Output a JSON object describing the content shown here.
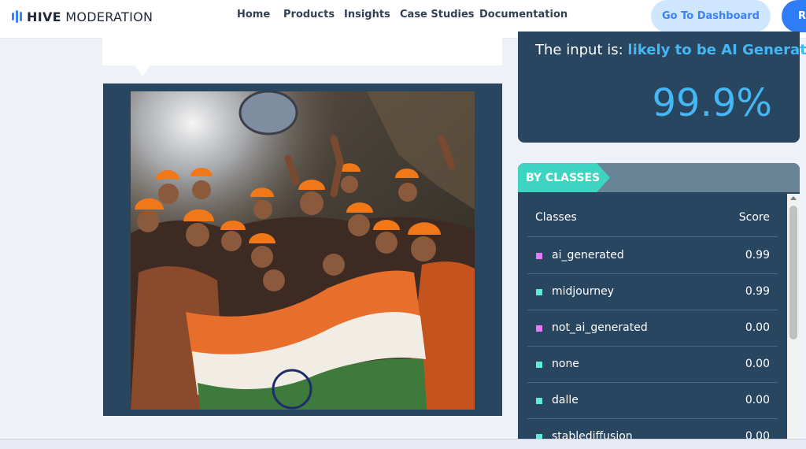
{
  "nav": {
    "brand_bold": "HIVE",
    "brand_light": "MODERATION",
    "links": [
      "Home",
      "Products",
      "Insights",
      "Case Studies",
      "Documentation"
    ],
    "dashboard_button": "Go To Dashboard",
    "cta_button_partial": "R"
  },
  "result": {
    "prefix": "The input is:",
    "verdict": "likely to be AI Generated",
    "percentage": "99.9%",
    "highlight_color": "#45b7f4"
  },
  "classes": {
    "tab_label": "BY CLASSES",
    "col_classes": "Classes",
    "col_score": "Score",
    "rows": [
      {
        "name": "ai_generated",
        "score": "0.99",
        "marker_color": "#e879f9"
      },
      {
        "name": "midjourney",
        "score": "0.99",
        "marker_color": "#5eead4"
      },
      {
        "name": "not_ai_generated",
        "score": "0.00",
        "marker_color": "#e879f9"
      },
      {
        "name": "none",
        "score": "0.00",
        "marker_color": "#5eead4"
      },
      {
        "name": "dalle",
        "score": "0.00",
        "marker_color": "#5eead4"
      },
      {
        "name": "stablediffusion",
        "score": "0.00",
        "marker_color": "#5eead4"
      }
    ]
  },
  "colors": {
    "panel": "#294660",
    "accent_teal": "#3dd5c2",
    "brand_blue": "#3b82f6"
  }
}
